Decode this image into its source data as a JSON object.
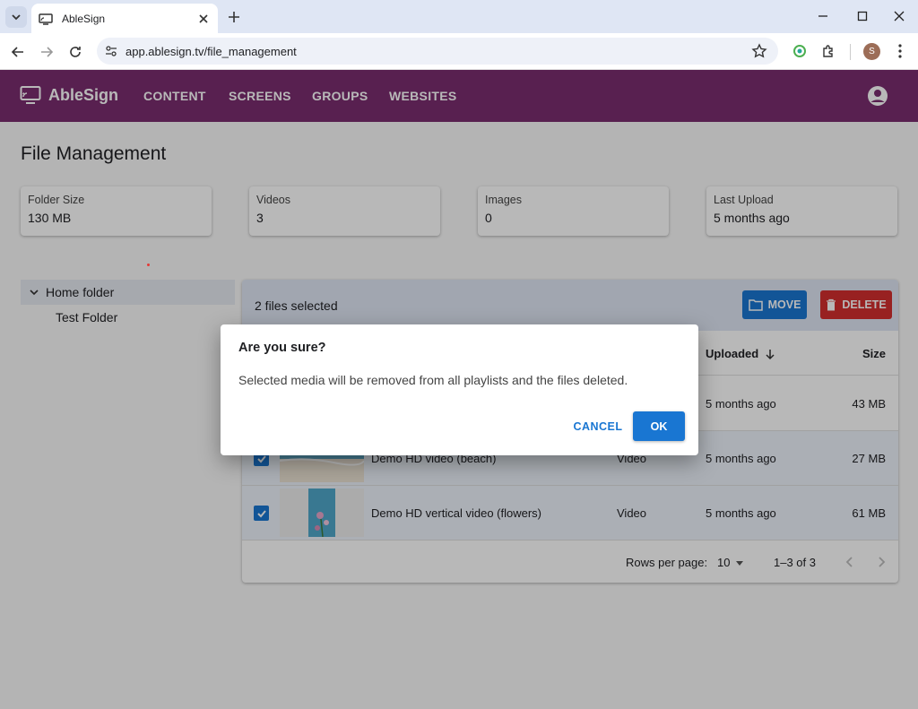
{
  "browser": {
    "tab_title": "AbleSign",
    "url": "app.ablesign.tv/file_management",
    "profile_initial": "S"
  },
  "app": {
    "brand": "AbleSign",
    "nav": [
      "CONTENT",
      "SCREENS",
      "GROUPS",
      "WEBSITES"
    ],
    "accent_color": "#7a2d6f"
  },
  "page": {
    "title": "File Management",
    "stats": [
      {
        "label": "Folder Size",
        "value": "130 MB"
      },
      {
        "label": "Videos",
        "value": "3"
      },
      {
        "label": "Images",
        "value": "0"
      },
      {
        "label": "Last Upload",
        "value": "5 months ago"
      }
    ]
  },
  "folders": {
    "root": "Home folder",
    "children": [
      "Test Folder"
    ]
  },
  "files": {
    "selected_text": "2 files selected",
    "move_label": "MOVE",
    "delete_label": "DELETE",
    "columns": {
      "uploaded": "Uploaded",
      "size": "Size"
    },
    "rows": [
      {
        "name": "",
        "type": "",
        "uploaded": "5 months ago",
        "size": "43 MB",
        "selected": false
      },
      {
        "name": "Demo HD video (beach)",
        "type": "Video",
        "uploaded": "5 months ago",
        "size": "27 MB",
        "selected": true
      },
      {
        "name": "Demo HD vertical video (flowers)",
        "type": "Video",
        "uploaded": "5 months ago",
        "size": "61 MB",
        "selected": true
      }
    ],
    "pagination": {
      "rows_per_page_label": "Rows per page:",
      "rows_per_page": "10",
      "range": "1–3 of 3"
    }
  },
  "dialog": {
    "title": "Are you sure?",
    "message": "Selected media will be removed from all playlists and the files deleted.",
    "cancel_label": "CANCEL",
    "ok_label": "OK"
  }
}
